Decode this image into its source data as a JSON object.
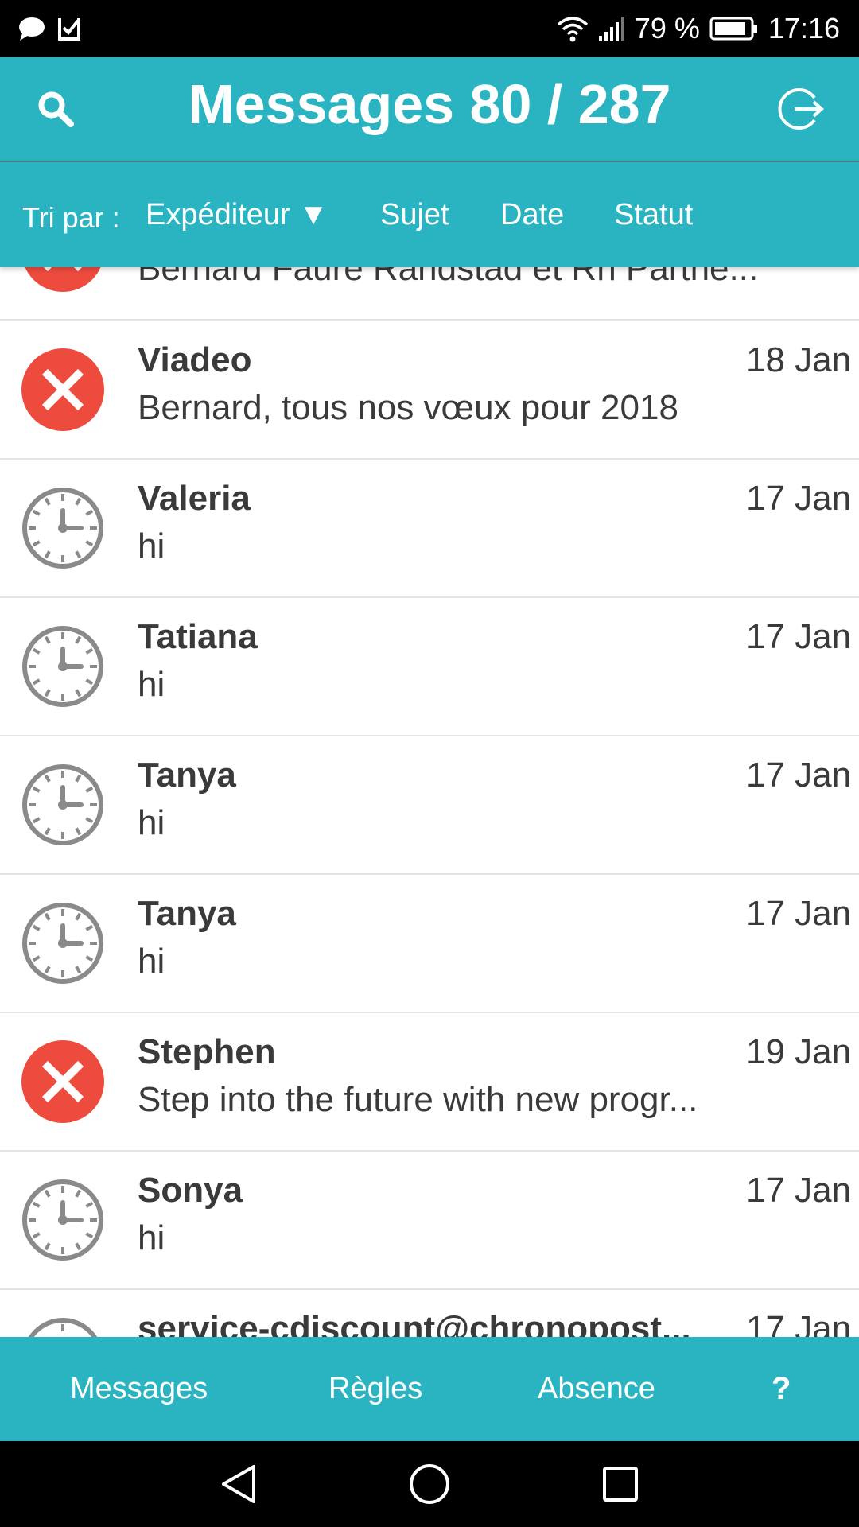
{
  "status_bar": {
    "battery": "79 %",
    "time": "17:16",
    "left_icons": [
      "chat-bubble-icon",
      "check-bag-icon"
    ],
    "right_icons": [
      "wifi-icon",
      "signal-icon",
      "battery-icon"
    ]
  },
  "header": {
    "title": "Messages 80 / 287",
    "search_icon": "search-icon",
    "logout_icon": "logout-icon"
  },
  "sort_bar": {
    "label": "Tri par :",
    "options": [
      "Expéditeur ▼",
      "Sujet",
      "Date",
      "Statut"
    ]
  },
  "messages": [
    {
      "status": "rejected",
      "sender": "",
      "date": "",
      "subject": "Bernard Faure Randstad et Rh Partne..."
    },
    {
      "status": "rejected",
      "sender": "Viadeo",
      "date": "18 Jan",
      "subject": "Bernard, tous nos vœux pour 2018"
    },
    {
      "status": "pending",
      "sender": "Valeria",
      "date": "17 Jan",
      "subject": "hi"
    },
    {
      "status": "pending",
      "sender": "Tatiana",
      "date": "17 Jan",
      "subject": "hi"
    },
    {
      "status": "pending",
      "sender": "Tanya",
      "date": "17 Jan",
      "subject": "hi"
    },
    {
      "status": "pending",
      "sender": "Tanya",
      "date": "17 Jan",
      "subject": "hi"
    },
    {
      "status": "rejected",
      "sender": "Stephen",
      "date": "19 Jan",
      "subject": "Step into the future with new progr..."
    },
    {
      "status": "pending",
      "sender": "Sonya",
      "date": "17 Jan",
      "subject": "hi"
    },
    {
      "status": "pending",
      "sender": "service-cdiscount@chronopost...",
      "date": "17 Jan",
      "subject": ""
    }
  ],
  "tab_bar": {
    "tabs": [
      "Messages",
      "Règles",
      "Absence",
      "?"
    ]
  },
  "nav_bar": {
    "icons": [
      "back-triangle-icon",
      "home-circle-icon",
      "recents-square-icon"
    ]
  },
  "colors": {
    "accent": "#2ab3c0",
    "rejected": "#ee4b3f",
    "pending": "#8a8a8a",
    "text": "#3a3a3a",
    "divider": "#e3e3e3"
  }
}
